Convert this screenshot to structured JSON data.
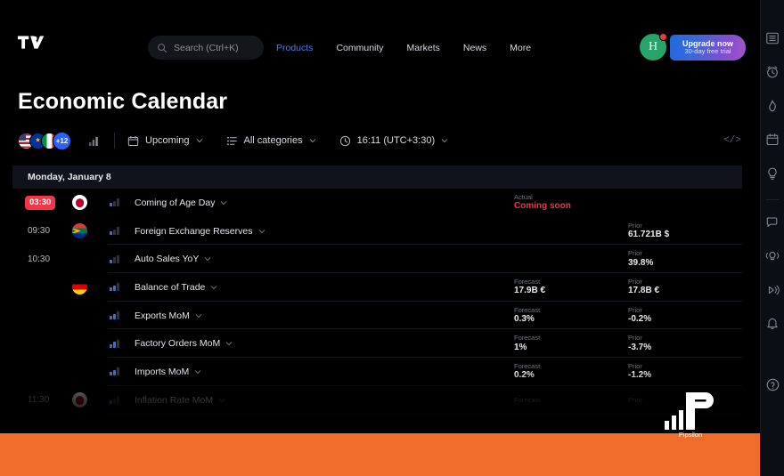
{
  "nav": {
    "logo": "tradingview-logo",
    "search_placeholder": "Search (Ctrl+K)",
    "links": [
      {
        "label": "Products",
        "active": true
      },
      {
        "label": "Community",
        "active": false
      },
      {
        "label": "Markets",
        "active": false
      },
      {
        "label": "News",
        "active": false
      },
      {
        "label": "More",
        "active": false
      }
    ],
    "avatar_letter": "H",
    "upgrade_title": "Upgrade now",
    "upgrade_sub": "30-day free trial"
  },
  "page": {
    "title": "Economic Calendar"
  },
  "toolbar": {
    "flags": [
      "US",
      "EU",
      "IT"
    ],
    "flag_more": "+12",
    "importance_icon": "bar-chart-icon",
    "filters": [
      {
        "icon": "calendar-icon",
        "label": "Upcoming"
      },
      {
        "icon": "list-icon",
        "label": "All categories"
      },
      {
        "icon": "clock-icon",
        "label": "16:11 (UTC+3:30)"
      }
    ],
    "embed_label": "</>"
  },
  "calendar": {
    "date_header": "Monday, January 8",
    "rows": [
      {
        "time": "03:30",
        "time_highlight": true,
        "flag": "JP",
        "impact": 1,
        "event": "Coming of Age Day",
        "col1_key": "Actual",
        "col1_value": "Coming soon",
        "col1_alert": true,
        "col2_key": "",
        "col2_value": ""
      },
      {
        "time": "09:30",
        "time_highlight": false,
        "flag": "ZA",
        "impact": 1,
        "event": "Foreign Exchange Reserves",
        "col1_key": "",
        "col1_value": "",
        "col2_key": "Prior",
        "col2_value": "61.721B $"
      },
      {
        "time": "10:30",
        "time_highlight": false,
        "flag": "",
        "impact": 1,
        "event": "Auto Sales YoY",
        "col1_key": "",
        "col1_value": "",
        "col2_key": "Prior",
        "col2_value": "39.8%"
      },
      {
        "time": "",
        "time_highlight": false,
        "flag": "DE",
        "impact": 2,
        "event": "Balance of Trade",
        "col1_key": "Forecast",
        "col1_value": "17.9B €",
        "col2_key": "Prior",
        "col2_value": "17.8B €"
      },
      {
        "time": "",
        "time_highlight": false,
        "flag": "",
        "impact": 2,
        "event": "Exports MoM",
        "col1_key": "Forecast",
        "col1_value": "0.3%",
        "col2_key": "Prior",
        "col2_value": "-0.2%"
      },
      {
        "time": "",
        "time_highlight": false,
        "flag": "",
        "impact": 2,
        "event": "Factory Orders MoM",
        "col1_key": "Forecast",
        "col1_value": "1%",
        "col2_key": "Prior",
        "col2_value": "-3.7%"
      },
      {
        "time": "",
        "time_highlight": false,
        "flag": "",
        "impact": 2,
        "event": "Imports MoM",
        "col1_key": "Forecast",
        "col1_value": "0.2%",
        "col2_key": "Prior",
        "col2_value": "-1.2%"
      },
      {
        "time": "11:30",
        "time_highlight": false,
        "flag": "JP",
        "impact": 1,
        "event": "Inflation Rate MoM",
        "col1_key": "Forecast",
        "col1_value": "",
        "col2_key": "Prior",
        "col2_value": ""
      }
    ]
  },
  "rail": {
    "items": [
      "watchlist-icon",
      "alarm-clock-icon",
      "hotlist-flame-icon",
      "calendar-icon",
      "ideas-bulb-icon",
      "chat-bubble-icon",
      "broadcast-bulb-icon",
      "stream-play-icon",
      "bell-icon"
    ],
    "help": "?"
  },
  "watermark": {
    "name": "Pipsilon"
  },
  "colors": {
    "accent_blue": "#2962ff",
    "alert_red": "#f23645",
    "brand_orange": "#ef6c2b",
    "avatar_green": "#27a468"
  }
}
